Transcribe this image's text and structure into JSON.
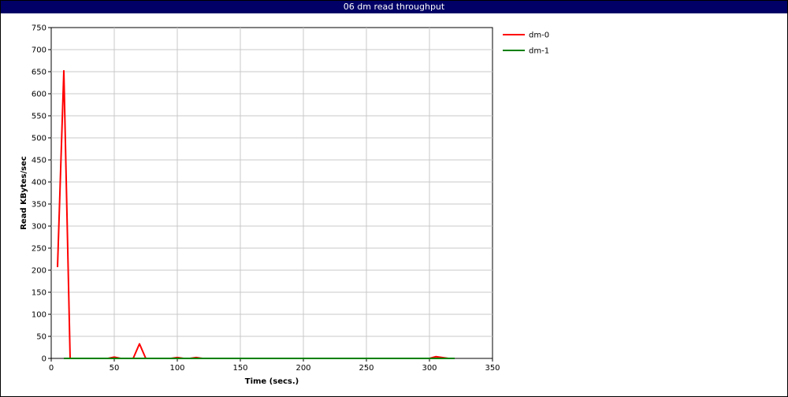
{
  "window": {
    "title": "06 dm read throughput"
  },
  "chart_data": {
    "type": "line",
    "title": "06 dm read throughput",
    "xlabel": "Time (secs.)",
    "ylabel": "Read KBytes/sec",
    "xlim": [
      0,
      350
    ],
    "ylim": [
      0,
      750
    ],
    "xticks": [
      0,
      50,
      100,
      150,
      200,
      250,
      300,
      350
    ],
    "yticks": [
      0,
      50,
      100,
      150,
      200,
      250,
      300,
      350,
      400,
      450,
      500,
      550,
      600,
      650,
      700,
      750
    ],
    "grid": true,
    "legend_position": "right",
    "series": [
      {
        "name": "dm-0",
        "color": "#ff0000",
        "points": [
          [
            5,
            207
          ],
          [
            10,
            652
          ],
          [
            15,
            0
          ],
          [
            45,
            0
          ],
          [
            50,
            3
          ],
          [
            55,
            0
          ],
          [
            65,
            0
          ],
          [
            70,
            33
          ],
          [
            75,
            0
          ],
          [
            95,
            0
          ],
          [
            100,
            2
          ],
          [
            105,
            0
          ],
          [
            110,
            0
          ],
          [
            115,
            2
          ],
          [
            120,
            0
          ],
          [
            300,
            0
          ],
          [
            305,
            4
          ],
          [
            310,
            2
          ],
          [
            315,
            0
          ]
        ]
      },
      {
        "name": "dm-1",
        "color": "#008000",
        "points": [
          [
            10,
            0
          ],
          [
            320,
            0
          ]
        ]
      }
    ]
  }
}
